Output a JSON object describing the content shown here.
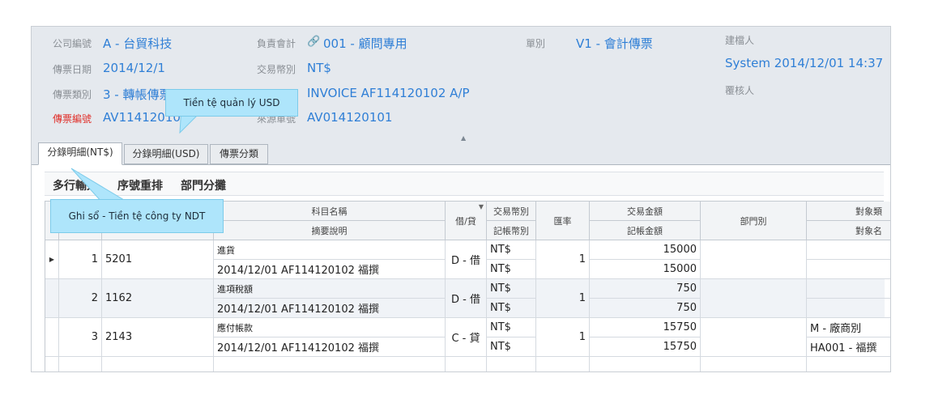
{
  "header": {
    "company_label": "公司編號",
    "company_value": "A - 台貿科技",
    "accountant_label": "負責會計",
    "accountant_value": "001 - 顧問專用",
    "doc_type_label": "單別",
    "doc_type_value": "V1 - 會計傳票",
    "creator_label": "建檔人",
    "creator_value": "System 2014/12/01 14:37",
    "voucher_date_label": "傳票日期",
    "voucher_date_value": "2014/12/1",
    "trade_currency_label": "交易幣別",
    "trade_currency_value": "NT$",
    "voucher_category_label": "傳票類別",
    "voucher_category_value": "3 - 轉帳傳票",
    "reference_value": "INVOICE AF114120102 A/P",
    "reviewer_label": "覆核人",
    "voucher_no_label": "傳票編號",
    "voucher_no_value": "AV114120102",
    "second_no_label": "來源單號",
    "second_no_value": "AV014120101"
  },
  "tabs": [
    {
      "label": "分錄明細(NT$)",
      "active": true
    },
    {
      "label": "分錄明細(USD)",
      "active": false
    },
    {
      "label": "傳票分類",
      "active": false
    }
  ],
  "toolbar": {
    "multi_row_label": "多行輸入",
    "reorder_label": "序號重排",
    "dept_label": "部門分攤"
  },
  "grid": {
    "headers": {
      "account_name": "科目名稱",
      "summary": "摘要說明",
      "debit_credit": "借/貸",
      "trade_currency": "交易幣別",
      "book_currency": "記帳幣別",
      "rate": "匯率",
      "trade_amount": "交易金額",
      "book_amount": "記帳金額",
      "department": "部門別",
      "target": "對象類",
      "target_name": "對象名"
    },
    "rows": [
      {
        "no": "1",
        "account": "5201",
        "name": "進貨",
        "summary": "2014/12/01 AF114120102 福撰",
        "dc": "D - 借",
        "trade_currency": "NT$",
        "book_currency": "NT$",
        "rate": "1",
        "trade_amount": "15000",
        "book_amount": "15000",
        "department": "",
        "target": "",
        "target_name": "",
        "current": true
      },
      {
        "no": "2",
        "account": "1162",
        "name": "進項稅額",
        "summary": "2014/12/01 AF114120102 福撰",
        "dc": "D - 借",
        "trade_currency": "NT$",
        "book_currency": "NT$",
        "rate": "1",
        "trade_amount": "750",
        "book_amount": "750",
        "department": "",
        "target": "",
        "target_name": "",
        "current": false
      },
      {
        "no": "3",
        "account": "2143",
        "name": "應付帳款",
        "summary": "2014/12/01 AF114120102 福撰",
        "dc": "C - 貸",
        "trade_currency": "NT$",
        "book_currency": "NT$",
        "rate": "1",
        "trade_amount": "15750",
        "book_amount": "15750",
        "department": "",
        "target": "M - 廠商別",
        "target_name": "HA001 - 福撰",
        "current": false
      }
    ]
  },
  "callouts": {
    "usd": "Tiền tệ quản lý USD",
    "ndt": "Ghi sổ - Tiền tệ công ty NDT"
  },
  "icons": {
    "link": "link-icon",
    "collapse": "collapse-up-icon",
    "row_pointer": "row-pointer-icon",
    "sort": "sort-icon"
  },
  "colors": {
    "value_blue": "#2f7fd6",
    "label_red": "#e0302a",
    "callout_bg": "#aee5fb",
    "header_bg": "#e5e9ee"
  }
}
